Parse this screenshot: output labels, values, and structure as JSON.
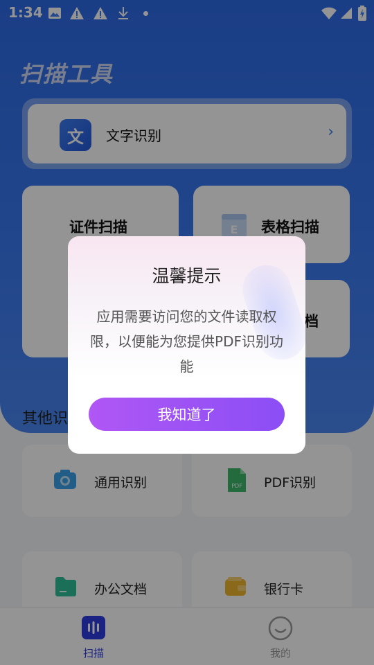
{
  "status_bar": {
    "time": "1:34",
    "icons": [
      "image-icon",
      "warning-icon",
      "warning-icon",
      "download-icon",
      "dot-icon",
      "wifi-icon",
      "signal-icon",
      "battery-charging-icon"
    ]
  },
  "app": {
    "title": "扫描工具"
  },
  "main": {
    "ocr": {
      "icon_text": "文",
      "label": "文字识别",
      "chevron": "›"
    },
    "tiles": {
      "id_scan": "证件扫描",
      "table_scan": "表格扫描",
      "doc_scan_partial": "档"
    }
  },
  "other": {
    "title": "其他识",
    "items": [
      {
        "label": "通用识别",
        "icon": "camera-icon",
        "color": "#3aa0e8"
      },
      {
        "label": "PDF识别",
        "icon": "pdf-file-icon",
        "color": "#3db86a",
        "icon_text": "PDF"
      },
      {
        "label": "办公文档",
        "icon": "folder-icon",
        "color": "#2fbf9a"
      },
      {
        "label": "银行卡",
        "icon": "wallet-icon",
        "color": "#f0b52e"
      }
    ]
  },
  "tabbar": {
    "tabs": [
      {
        "label": "扫描",
        "icon": "scan-icon",
        "active": true,
        "color": "#2d3be0"
      },
      {
        "label": "我的",
        "icon": "smile-icon",
        "active": false,
        "color": "#9a9a9a"
      }
    ]
  },
  "dialog": {
    "title": "温馨提示",
    "message": "应用需要访问您的文件读取权限，以便能为您提供PDF识别功能",
    "button": "我知道了"
  },
  "colors": {
    "primary_blue": "#3b7af0",
    "dialog_button": "#9a52f5",
    "tab_active": "#2d3be0"
  }
}
